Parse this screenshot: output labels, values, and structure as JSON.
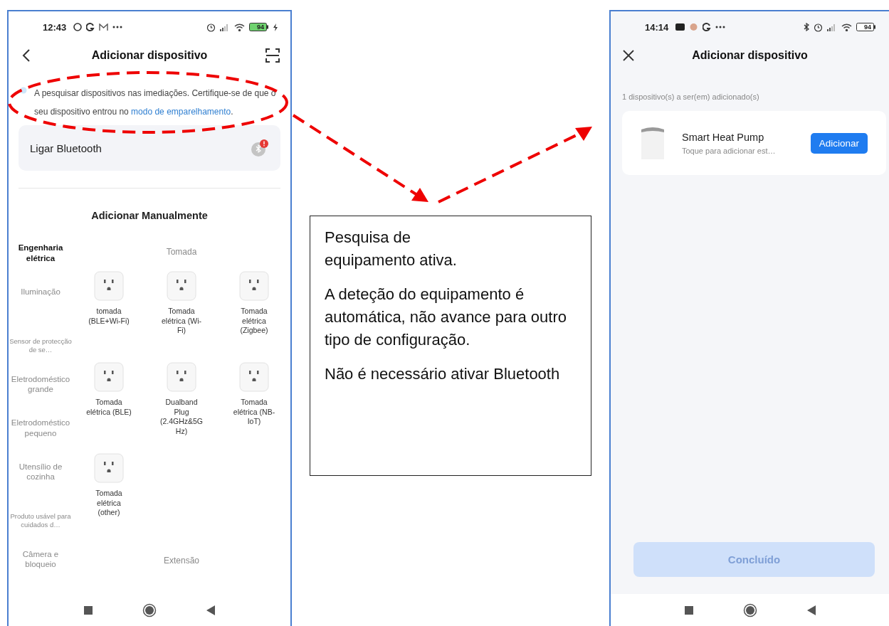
{
  "left_screen": {
    "status_bar": {
      "time": "12:43",
      "battery": "94",
      "charging": true
    },
    "header": {
      "title": "Adicionar dispositivo"
    },
    "notice": {
      "text": "A pesquisar dispositivos nas imediações. Certifique-se de que o seu dispositivo entrou no",
      "link": "modo de emparelhamento",
      "end": "."
    },
    "bluetooth_card": {
      "label": "Ligar Bluetooth",
      "alert": true
    },
    "section_title": "Adicionar Manualmente",
    "categories": [
      {
        "label": "Engenharia elétrica",
        "selected": true
      },
      {
        "label": "Iluminação",
        "selected": false
      },
      {
        "label": "Sensor de protecção de se…",
        "selected": false,
        "small": true
      },
      {
        "label": "Eletrodoméstico grande",
        "selected": false
      },
      {
        "label": "Eletrodoméstico pequeno",
        "selected": false
      },
      {
        "label": "Utensílio de cozinha",
        "selected": false
      },
      {
        "label": "Produto usável para cuidados d…",
        "selected": false,
        "small": true
      },
      {
        "label": "Câmera e bloqueio",
        "selected": false
      }
    ],
    "groups": [
      {
        "title": "Tomada",
        "devices": [
          {
            "label": "tomada (BLE+Wi-Fi)"
          },
          {
            "label": "Tomada elétrica (Wi-Fi)"
          },
          {
            "label": "Tomada elétrica (Zigbee)"
          },
          {
            "label": "Tomada elétrica (BLE)"
          },
          {
            "label": "Dualband Plug (2.4GHz&5GHz)"
          },
          {
            "label": "Tomada elétrica (NB-IoT)"
          },
          {
            "label": "Tomada elétrica (other)"
          }
        ]
      },
      {
        "title": "Extensão"
      }
    ]
  },
  "annotation": {
    "paragraphs": [
      "Pesquisa de equipamento ativa.",
      "A deteção do equipamento é automática, não avance para outro tipo de configuração.",
      "Não é necessário ativar Bluetooth"
    ]
  },
  "right_screen": {
    "status_bar": {
      "time": "14:14",
      "battery": "94",
      "charging": false
    },
    "header": {
      "title": "Adicionar dispositivo"
    },
    "count_text": "1 dispositivo(s) a ser(em) adicionado(s)",
    "devices": [
      {
        "name": "Smart Heat Pump",
        "hint": "Toque para adicionar est…",
        "action": "Adicionar"
      }
    ],
    "done_button": {
      "label": "Concluído",
      "disabled": true
    }
  }
}
